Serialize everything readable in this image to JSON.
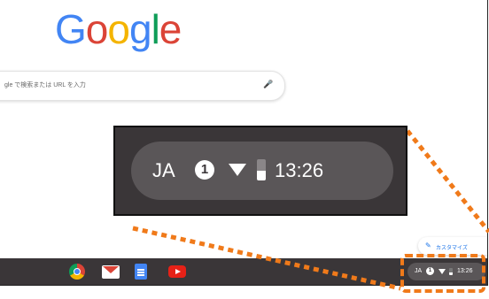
{
  "google_logo": {
    "letters": [
      "G",
      "o",
      "o",
      "g",
      "l",
      "e"
    ],
    "colors": [
      "#4285f4",
      "#db4437",
      "#f4b400",
      "#4285f4",
      "#0f9d58",
      "#db4437"
    ]
  },
  "search": {
    "placeholder": "gle で検索または URL を入力",
    "mic_icon": "mic-icon"
  },
  "customize": {
    "label": "カスタマイズ",
    "icon": "pencil-icon"
  },
  "shelf": {
    "apps": [
      {
        "name": "chrome-icon"
      },
      {
        "name": "gmail-icon"
      },
      {
        "name": "docs-icon"
      },
      {
        "name": "youtube-icon"
      }
    ],
    "status": {
      "ime": "JA",
      "notifications": "1",
      "time": "13:26"
    }
  },
  "callout": {
    "ime": "JA",
    "notifications": "1",
    "time": "13:26"
  },
  "colors": {
    "highlight": "#f07a1a",
    "shelf": "#3a3638",
    "status_pill": "#5a5658"
  }
}
